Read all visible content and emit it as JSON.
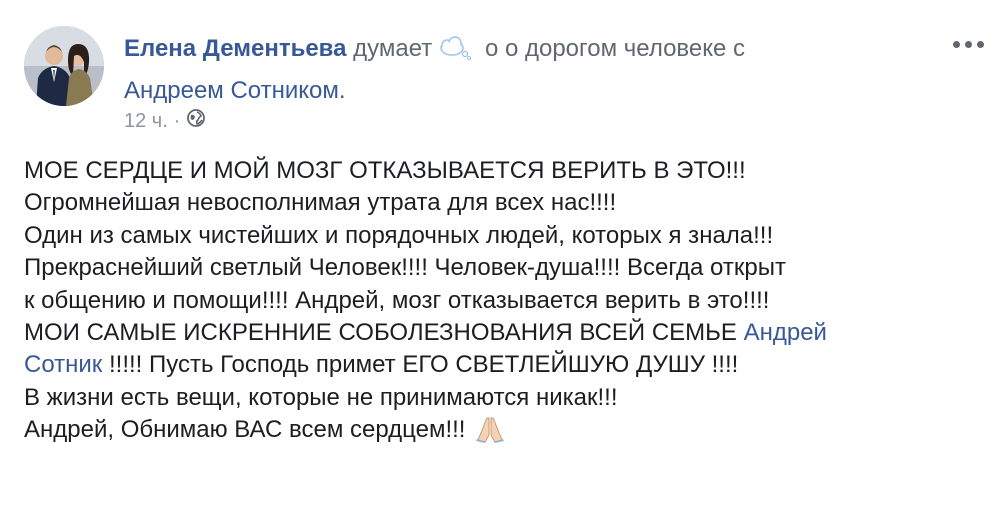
{
  "post": {
    "author_name": "Елена Дементьева",
    "feeling_verb": "думает",
    "feeling_icon": "thought-bubble-icon",
    "feeling_text": "о о дорогом человеке с",
    "tagged_person": "Андреем Сотником.",
    "timestamp": "12 ч.",
    "separator": "·",
    "privacy_icon": "globe-icon",
    "more_icon": "ellipsis-icon",
    "lines": [
      "МОЕ СЕРДЦЕ И МОЙ МОЗГ ОТКАЗЫВАЕТСЯ ВЕРИТЬ В ЭТО!!!",
      "Огромнейшая невосполнимая утрата для всех нас!!!!",
      "Один из самых чистейших и порядочных людей, которых я знала!!!",
      "Прекраснейший светлый Человек!!!! Человек-душа!!!! Всегда открыт",
      "к общению и помощи!!!! Андрей, мозг отказывается верить в это!!!!",
      "МОИ САМЫЕ ИСКРЕННИЕ СОБОЛЕЗНОВАНИЯ ВСЕЙ СЕМЬЕ"
    ],
    "mention_part1": "Андрей",
    "mention_part2": "Сотник",
    "line7_rest": " !!!!! Пусть Господь примет ЕГО СВЕТЛЕЙШУЮ ДУШУ !!!!",
    "line8": "В жизни есть вещи, которые не принимаются никак!!!",
    "line9": "Андрей, Обнимаю ВАС всем сердцем!!!",
    "end_icon": "praying-hands-icon",
    "colors": {
      "link": "#385898",
      "text": "#1c1e21",
      "secondary": "#606770",
      "meta": "#90949c"
    }
  }
}
